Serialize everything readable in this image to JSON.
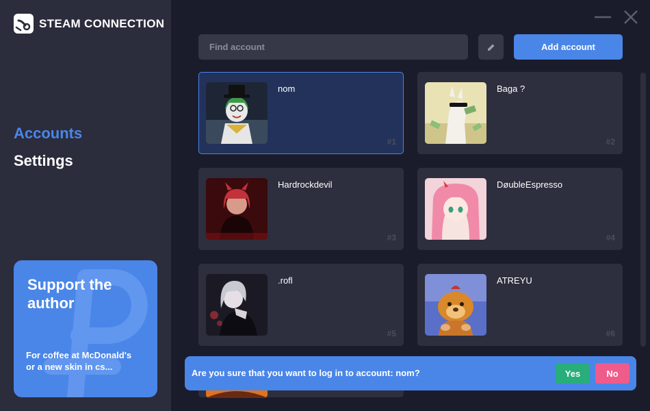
{
  "app": {
    "title": "STEAM CONNECTION",
    "logo_icon": "steam-connection-logo-icon"
  },
  "sidebar": {
    "items": [
      {
        "label": "Accounts",
        "active": true
      },
      {
        "label": "Settings",
        "active": false
      }
    ],
    "support": {
      "title": "Support the author",
      "text": "For coffee at McDonald's or a new skin in cs..."
    }
  },
  "window": {
    "minimize_icon": "minimize-icon",
    "close_icon": "close-icon"
  },
  "toolbar": {
    "search_placeholder": "Find account",
    "edit_icon": "pencil-icon",
    "add_label": "Add account"
  },
  "accounts": [
    {
      "name": "nom",
      "number": "#1",
      "selected": true
    },
    {
      "name": "Baga ?",
      "number": "#2",
      "selected": false
    },
    {
      "name": "Hardrockdevil",
      "number": "#3",
      "selected": false
    },
    {
      "name": "DøubleEspresso",
      "number": "#4",
      "selected": false
    },
    {
      "name": ".rofl",
      "number": "#5",
      "selected": false
    },
    {
      "name": "ATREYU",
      "number": "#6",
      "selected": false
    }
  ],
  "dialog": {
    "message": "Are you sure that you want to log in to account: nom?",
    "yes_label": "Yes",
    "no_label": "No"
  },
  "colors": {
    "accent": "#4a86e8",
    "yes": "#27ae7a",
    "no": "#ef5b8a",
    "sidebar_bg": "#2b2c3c",
    "main_bg": "#1b1c2b"
  }
}
